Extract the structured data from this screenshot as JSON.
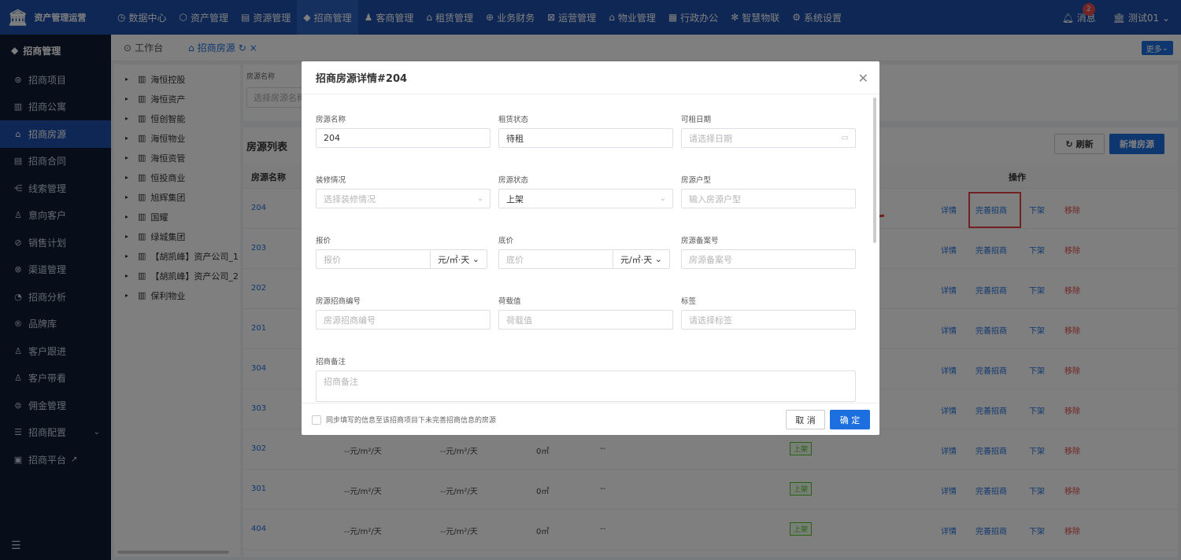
{
  "app": {
    "title": "资产管理运营"
  },
  "topnav": [
    {
      "icon": "◷",
      "label": "数据中心"
    },
    {
      "icon": "⬡",
      "label": "资产管理"
    },
    {
      "icon": "▤",
      "label": "资源管理"
    },
    {
      "icon": "◆",
      "label": "招商管理"
    },
    {
      "icon": "♟",
      "label": "客商管理"
    },
    {
      "icon": "⌂",
      "label": "租赁管理"
    },
    {
      "icon": "⊕",
      "label": "业务财务"
    },
    {
      "icon": "⊠",
      "label": "运营管理"
    },
    {
      "icon": "⌂",
      "label": "物业管理"
    },
    {
      "icon": "▦",
      "label": "行政办公"
    },
    {
      "icon": "✻",
      "label": "智慧物联"
    },
    {
      "icon": "⚙",
      "label": "系统设置"
    }
  ],
  "user": {
    "messages_label": "消息",
    "messages_count": "2",
    "name": "测试01"
  },
  "sidebar": {
    "title": "招商管理",
    "items": [
      {
        "icon": "⊛",
        "label": "招商项目"
      },
      {
        "icon": "▥",
        "label": "招商公寓"
      },
      {
        "icon": "⌂",
        "label": "招商房源"
      },
      {
        "icon": "▤",
        "label": "招商合同"
      },
      {
        "icon": "⋲",
        "label": "线索管理"
      },
      {
        "icon": "♙",
        "label": "意向客户"
      },
      {
        "icon": "⊘",
        "label": "销售计划"
      },
      {
        "icon": "⊗",
        "label": "渠道管理"
      },
      {
        "icon": "◔",
        "label": "招商分析"
      },
      {
        "icon": "®",
        "label": "品牌库"
      },
      {
        "icon": "♙",
        "label": "客户跟进"
      },
      {
        "icon": "♙",
        "label": "客户带看"
      },
      {
        "icon": "⊜",
        "label": "佣金管理"
      },
      {
        "icon": "☰",
        "label": "招商配置"
      },
      {
        "icon": "▣",
        "label": "招商平台"
      }
    ]
  },
  "tabs": [
    {
      "icon": "⊙",
      "label": "工作台"
    },
    {
      "icon": "⌂",
      "label": "招商房源"
    }
  ],
  "more_label": "更多",
  "tree": [
    "海恒控股",
    "海恒资产",
    "恒创智能",
    "海恒物业",
    "海恒资管",
    "恒投商业",
    "旭辉集团",
    "国耀",
    "绿城集团",
    "【胡凯峰】资产公司_1",
    "【胡凯峰】资产公司_2",
    "保利物业"
  ],
  "filter": {
    "label": "房源名称",
    "placeholder": "选择房源名称"
  },
  "list": {
    "title": "房源列表",
    "refresh_label": "刷新",
    "new_label": "新增房源",
    "headers": {
      "name": "房源名称",
      "ops": "操作"
    },
    "actions": {
      "detail": "详情",
      "complete": "完善招商",
      "offline": "下架",
      "remove": "移除"
    },
    "rows": [
      {
        "room": "204",
        "price": "",
        "floor": "",
        "area": "",
        "remark": "",
        "status": ""
      },
      {
        "room": "203",
        "price": "",
        "floor": "",
        "area": "",
        "remark": "",
        "status": ""
      },
      {
        "room": "202",
        "price": "",
        "floor": "",
        "area": "",
        "remark": "",
        "status": ""
      },
      {
        "room": "201",
        "price": "",
        "floor": "",
        "area": "",
        "remark": "",
        "status": ""
      },
      {
        "room": "304",
        "price": "",
        "floor": "",
        "area": "",
        "remark": "",
        "status": ""
      },
      {
        "room": "303",
        "price": "",
        "floor": "",
        "area": "",
        "remark": "",
        "status": ""
      },
      {
        "room": "302",
        "price": "--元/m²/天",
        "floor": "--元/m²/天",
        "area": "0㎡",
        "remark": "--",
        "status": "上架"
      },
      {
        "room": "301",
        "price": "--元/m²/天",
        "floor": "--元/m²/天",
        "area": "0㎡",
        "remark": "--",
        "status": "上架"
      },
      {
        "room": "404",
        "price": "--元/m²/天",
        "floor": "--元/m²/天",
        "area": "0㎡",
        "remark": "--",
        "status": "上架"
      }
    ]
  },
  "modal": {
    "title": "招商房源详情#204",
    "fields": {
      "name": {
        "label": "房源名称",
        "value": "204"
      },
      "rent_status": {
        "label": "租赁状态",
        "value": "待租"
      },
      "rent_date": {
        "label": "可租日期",
        "placeholder": "请选择日期"
      },
      "decoration": {
        "label": "装修情况",
        "placeholder": "选择装修情况"
      },
      "room_status": {
        "label": "房源状态",
        "value": "上架"
      },
      "layout": {
        "label": "房源户型",
        "placeholder": "输入房源户型"
      },
      "price": {
        "label": "报价",
        "placeholder": "报价",
        "unit": "元/㎡·天"
      },
      "floor_price": {
        "label": "底价",
        "placeholder": "底价",
        "unit": "元/㎡·天"
      },
      "record_no": {
        "label": "房源备案号",
        "placeholder": "房源备案号"
      },
      "invest_no": {
        "label": "房源招商编号",
        "placeholder": "房源招商编号"
      },
      "load": {
        "label": "荷载值",
        "placeholder": "荷载值"
      },
      "tags": {
        "label": "标签",
        "placeholder": "请选择标签"
      },
      "remark": {
        "label": "招商备注",
        "placeholder": "招商备注"
      }
    },
    "sync_label": "同步填写的信息至该招商项目下未完善招商信息的房源",
    "cancel_label": "取 消",
    "ok_label": "确 定"
  },
  "colors": {
    "primary": "#1d4fa8",
    "accent": "#1d6fe0",
    "danger": "#e04545",
    "sidebar": "#0e1b33"
  }
}
